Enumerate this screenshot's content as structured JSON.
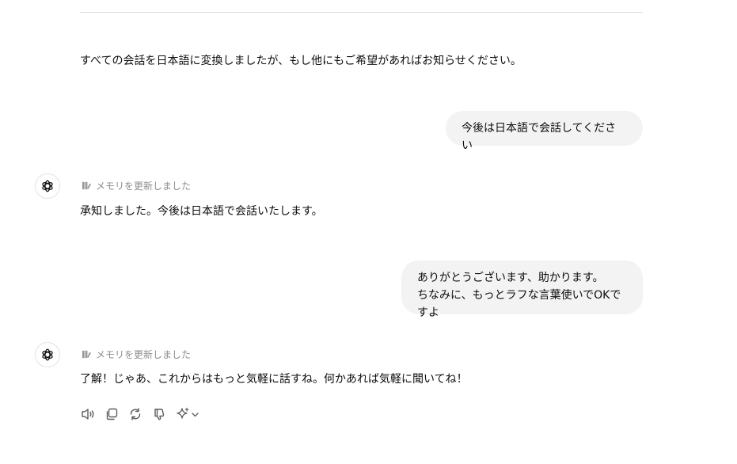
{
  "conversation": {
    "prev_assistant_text": "すべての会話を日本語に変換しましたが、もし他にもご希望があればお知らせください。",
    "user_msg_1": "今後は日本語で会話してください",
    "assistant_1": {
      "memory_label": "メモリを更新しました",
      "text": "承知しました。今後は日本語で会話いたします。"
    },
    "user_msg_2": {
      "line1": "ありがとうございます、助かります。",
      "line2": "ちなみに、もっとラフな言葉使いでOKですよ"
    },
    "assistant_2": {
      "memory_label": "メモリを更新しました",
      "text": "了解！じゃあ、これからはもっと気軽に話すね。何かあれば気軽に聞いてね！"
    }
  },
  "actions": {
    "icons": [
      "read-aloud-icon",
      "copy-icon",
      "regenerate-icon",
      "thumbs-down-icon",
      "sparkle-model-icon",
      "chevron-down-icon"
    ]
  },
  "colors": {
    "bubble": "#f3f3f3",
    "muted": "#8e8e8e",
    "text": "#0d0d0d"
  }
}
